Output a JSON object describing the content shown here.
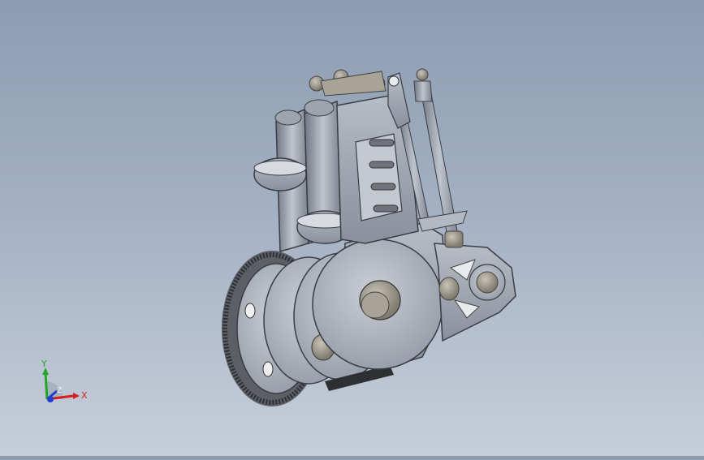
{
  "viewport": {
    "background_top": "#8d9cb1",
    "background_bottom": "#c6ced9"
  },
  "model": {
    "icon": "engine-assembly-model"
  },
  "triad": {
    "x_label": "X",
    "y_label": "Y",
    "z_label": "Z",
    "x_color": "#d62020",
    "y_color": "#22a822",
    "z_color": "#2040d0"
  }
}
